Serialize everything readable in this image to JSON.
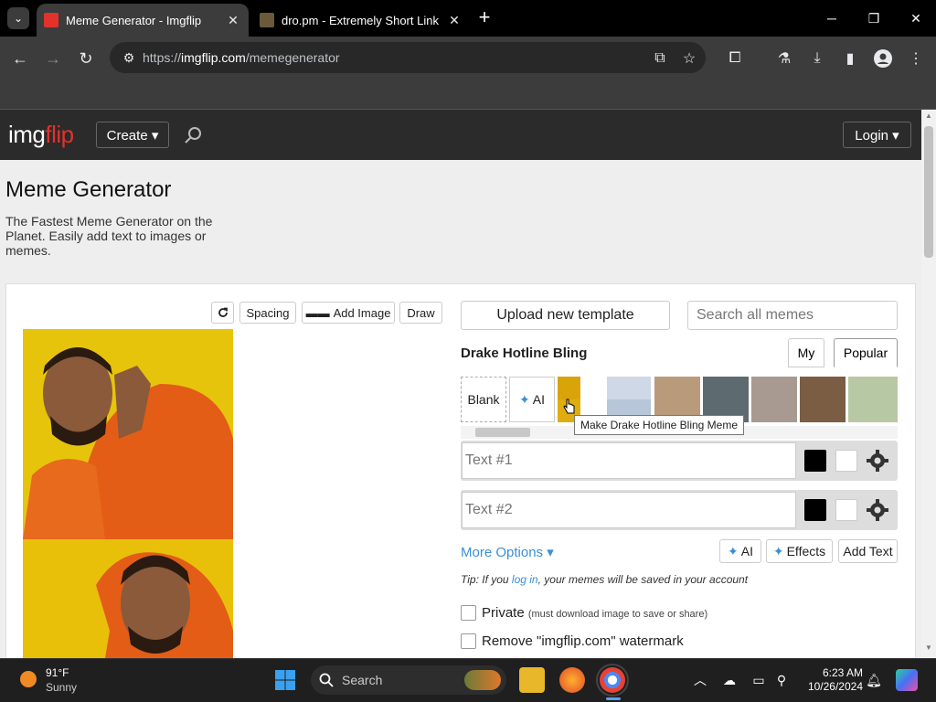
{
  "browser": {
    "tabs": [
      {
        "title": "Meme Generator - Imgflip",
        "active": true
      },
      {
        "title": "dro.pm - Extremely Short Link",
        "active": false
      }
    ],
    "tab_close": "✕",
    "new_tab": "+",
    "url_prefix": "https://",
    "url_domain": "imgflip.com",
    "url_path": "/memegenerator"
  },
  "site": {
    "logo_img": "img",
    "logo_flip": "flip",
    "create_label": "Create ▾",
    "login_label": "Login ▾",
    "page_title": "Meme Generator",
    "subtitle": "The Fastest Meme Generator on the Planet. Easily add text to images or memes."
  },
  "editor": {
    "toolbar": {
      "spacing": "Spacing",
      "add_image": "Add Image",
      "draw": "Draw"
    },
    "upload_label": "Upload new template",
    "search_placeholder": "Search all memes",
    "template_name": "Drake Hotline Bling",
    "tabs": {
      "my": "My",
      "popular": "Popular"
    },
    "blank_label": "Blank",
    "ai_label": "AI",
    "tooltip": "Make Drake Hotline Bling Meme",
    "text_placeholders": [
      "Text #1",
      "Text #2"
    ],
    "more_options": "More Options ▾",
    "opt_ai": "AI",
    "opt_effects": "Effects",
    "opt_add_text": "Add Text",
    "tip_prefix": "Tip: If you ",
    "tip_link": "log in",
    "tip_suffix": ", your memes will be saved in your account",
    "private_label": "Private",
    "private_note": "(must download image to save or share)",
    "watermark_label": "Remove \"imgflip.com\" watermark"
  },
  "taskbar": {
    "temperature": "91°F",
    "condition": "Sunny",
    "search_label": "Search",
    "time": "6:23 AM",
    "date": "10/26/2024"
  },
  "colors": {
    "accent_link": "#3a8fd8",
    "logo_red": "#e3322b",
    "header_bg": "#2b2b2b"
  }
}
